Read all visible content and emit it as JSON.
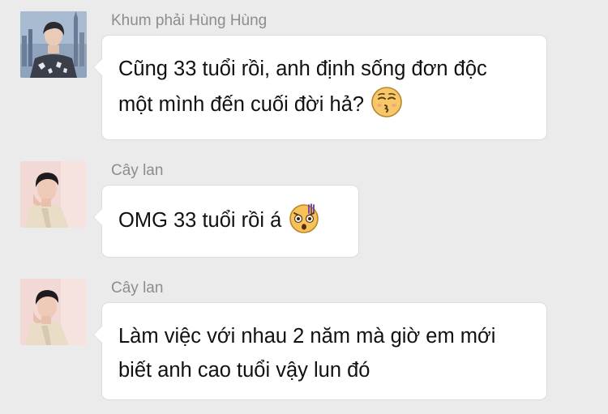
{
  "messages": [
    {
      "sender": "Khum phải Hùng Hùng",
      "lines": [
        "Cũng 33 tuổi rồi, anh định sống đơn độc",
        "một mình đến cuối đời hả?"
      ],
      "emoji": "smirk-kiss-emoji"
    },
    {
      "sender": "Cây lan",
      "lines": [
        "OMG 33 tuổi rồi á"
      ],
      "emoji": "shocked-flustered-emoji"
    },
    {
      "sender": "Cây lan",
      "lines": [
        "Làm việc với nhau 2 năm mà giờ em mới",
        "biết anh cao tuổi vậy lun đó"
      ]
    }
  ],
  "colors": {
    "background": "#ebebeb",
    "bubble": "#ffffff",
    "bubble_border": "#dcdcdc",
    "sender_name": "#8d8d8d",
    "message_text": "#111111"
  },
  "icons": {
    "avatar_1": "user-avatar-city-skyline",
    "avatar_2": "user-avatar-pink-portrait",
    "avatar_3": "user-avatar-pink-portrait"
  }
}
